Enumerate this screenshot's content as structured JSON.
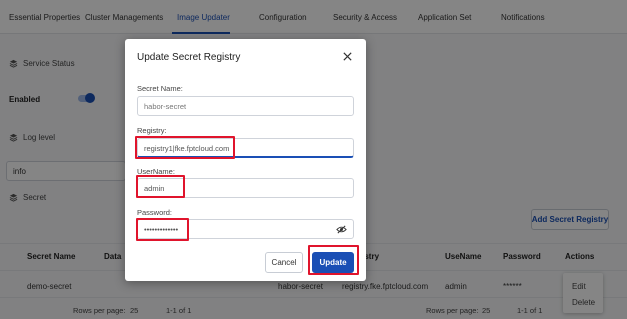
{
  "tabs": [
    {
      "label": "Essential Properties"
    },
    {
      "label": "Cluster Managements"
    },
    {
      "label": "Image Updater"
    },
    {
      "label": "Configuration"
    },
    {
      "label": "Security & Access"
    },
    {
      "label": "Application Set"
    },
    {
      "label": "Notifications"
    }
  ],
  "active_tab": "Image Updater",
  "sections": {
    "service_status": "Service Status",
    "enabled_label": "Enabled",
    "log_level": "Log level",
    "log_level_value": "info",
    "secret": "Secret"
  },
  "add_secret_button": "Add Secret Registry",
  "table": {
    "headers": [
      "Secret Name",
      "Data",
      "Registry",
      "UseName",
      "Password",
      "Actions"
    ],
    "row": {
      "secret_name": "demo-secret",
      "registry": "habor-secret",
      "registry_url": "registry.fke.fptcloud.com",
      "username": "admin",
      "password": "******"
    },
    "footer_left": {
      "rows_per_page_label": "Rows per page:",
      "rows_per_page": "25",
      "range": "1-1 of 1"
    },
    "footer_right": {
      "rows_per_page_label": "Rows per page:",
      "rows_per_page": "25",
      "range": "1-1 of 1"
    }
  },
  "context_menu": {
    "edit": "Edit",
    "delete": "Delete"
  },
  "modal": {
    "title": "Update Secret Registry",
    "secret_name_label": "Secret Name:",
    "secret_name_value": "habor-secret",
    "registry_label": "Registry:",
    "registry_value": "registry1|fke.fptcloud.com",
    "username_label": "UserName:",
    "username_value": "admin",
    "password_label": "Password:",
    "password_value": "•••••••••••••",
    "cancel_label": "Cancel",
    "update_label": "Update"
  },
  "colors": {
    "accent": "#1a4fb5",
    "highlight": "#e0142c"
  }
}
